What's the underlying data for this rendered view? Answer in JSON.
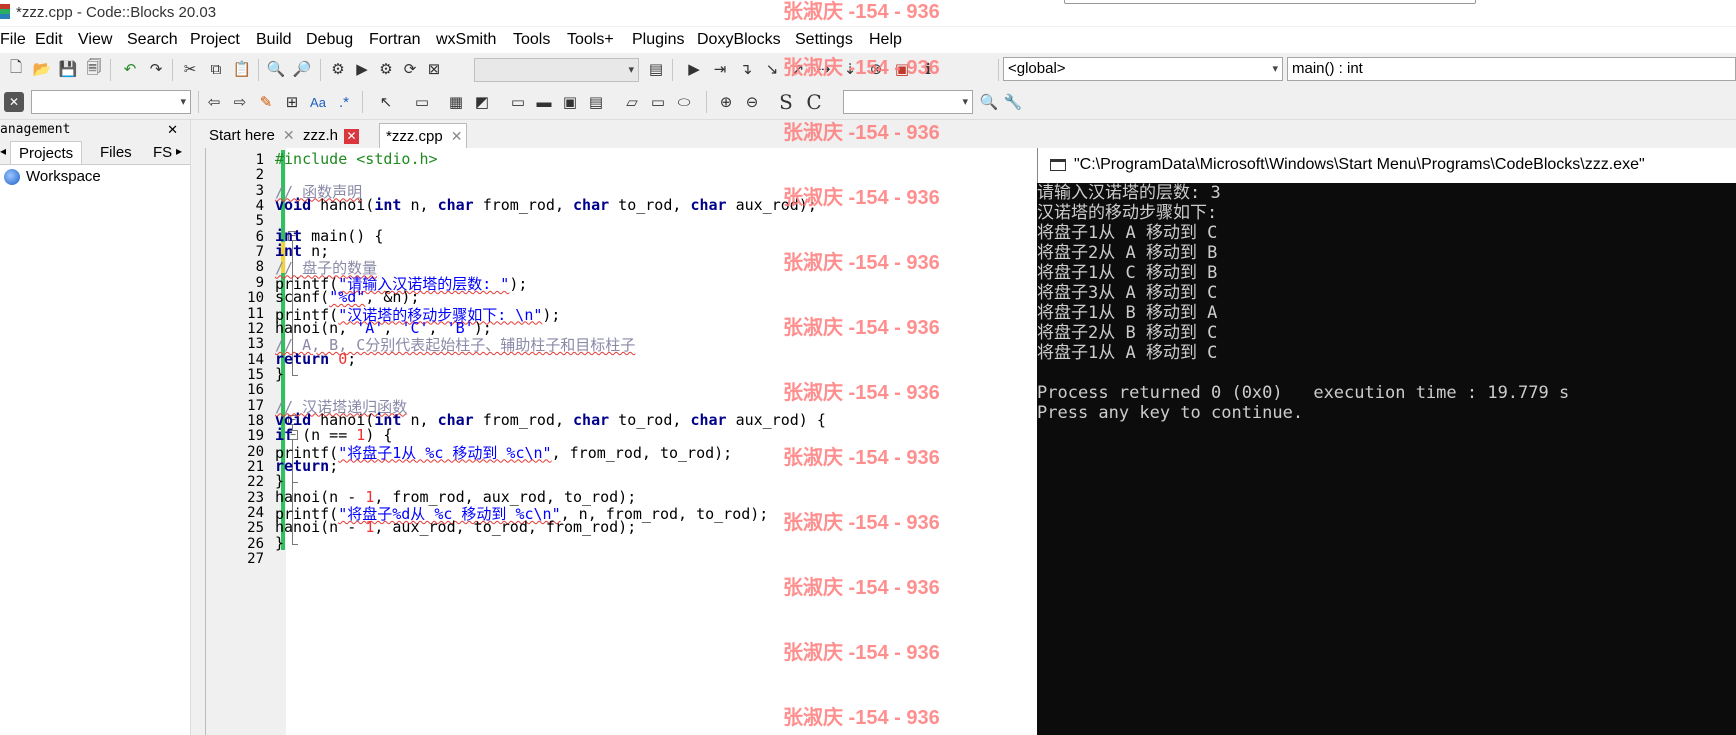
{
  "window": {
    "title": "*zzz.cpp - Code::Blocks 20.03"
  },
  "menu": [
    "File",
    "Edit",
    "View",
    "Search",
    "Project",
    "Build",
    "Debug",
    "Fortran",
    "wxSmith",
    "Tools",
    "Tools+",
    "Plugins",
    "DoxyBlocks",
    "Settings",
    "Help"
  ],
  "toolbar": {
    "scope_combo": "<global>",
    "function_combo": "main() : int"
  },
  "management": {
    "title": "anagement",
    "tabs": [
      "Projects",
      "Files",
      "FS"
    ],
    "tree": [
      "Workspace"
    ]
  },
  "editor": {
    "tabs": [
      {
        "label": "Start here",
        "close": "✕"
      },
      {
        "label": "zzz.h",
        "close": "✕"
      },
      {
        "label": "*zzz.cpp",
        "close": "✕"
      }
    ],
    "lines": [
      "#include <stdio.h>",
      "",
      "// 函数声明",
      "void hanoi(int n, char from_rod, char to_rod, char aux_rod);",
      "",
      "int main() {",
      "int n;",
      "// 盘子的数量",
      "printf(\"请输入汉诺塔的层数: \");",
      "scanf(\"%d\", &n);",
      "printf(\"汉诺塔的移动步骤如下: \\n\");",
      "hanoi(n, 'A', 'C', 'B');",
      "// A, B, C分别代表起始柱子、辅助柱子和目标柱子",
      "return 0;",
      "}",
      "",
      "// 汉诺塔递归函数",
      "void hanoi(int n, char from_rod, char to_rod, char aux_rod) {",
      "if (n == 1) {",
      "printf(\"将盘子1从 %c 移动到 %c\\n\", from_rod, to_rod);",
      "return;",
      "}",
      "hanoi(n - 1, from_rod, aux_rod, to_rod);",
      "printf(\"将盘子%d从 %c 移动到 %c\\n\", n, from_rod, to_rod);",
      "hanoi(n - 1, aux_rod, to_rod, from_rod);",
      "}",
      ""
    ]
  },
  "console": {
    "title": "\"C:\\ProgramData\\Microsoft\\Windows\\Start Menu\\Programs\\CodeBlocks\\zzz.exe\"",
    "lines": [
      "请输入汉诺塔的层数: 3",
      "汉诺塔的移动步骤如下:",
      "将盘子1从 A 移动到 C",
      "将盘子2从 A 移动到 B",
      "将盘子1从 C 移动到 B",
      "将盘子3从 A 移动到 C",
      "将盘子1从 B 移动到 A",
      "将盘子2从 B 移动到 C",
      "将盘子1从 A 移动到 C",
      "",
      "Process returned 0 (0x0)   execution time : 19.779 s",
      "Press any key to continue."
    ]
  },
  "watermark": "张淑庆 -154 - 936",
  "colors": {
    "keyword": "#00008b",
    "comment": "#8a8aa8",
    "string": "#0000ff",
    "number": "#f03030",
    "preprocessor": "#1f8a1f",
    "watermark": "#ff7b7b",
    "console_bg": "#0c0c0c"
  }
}
